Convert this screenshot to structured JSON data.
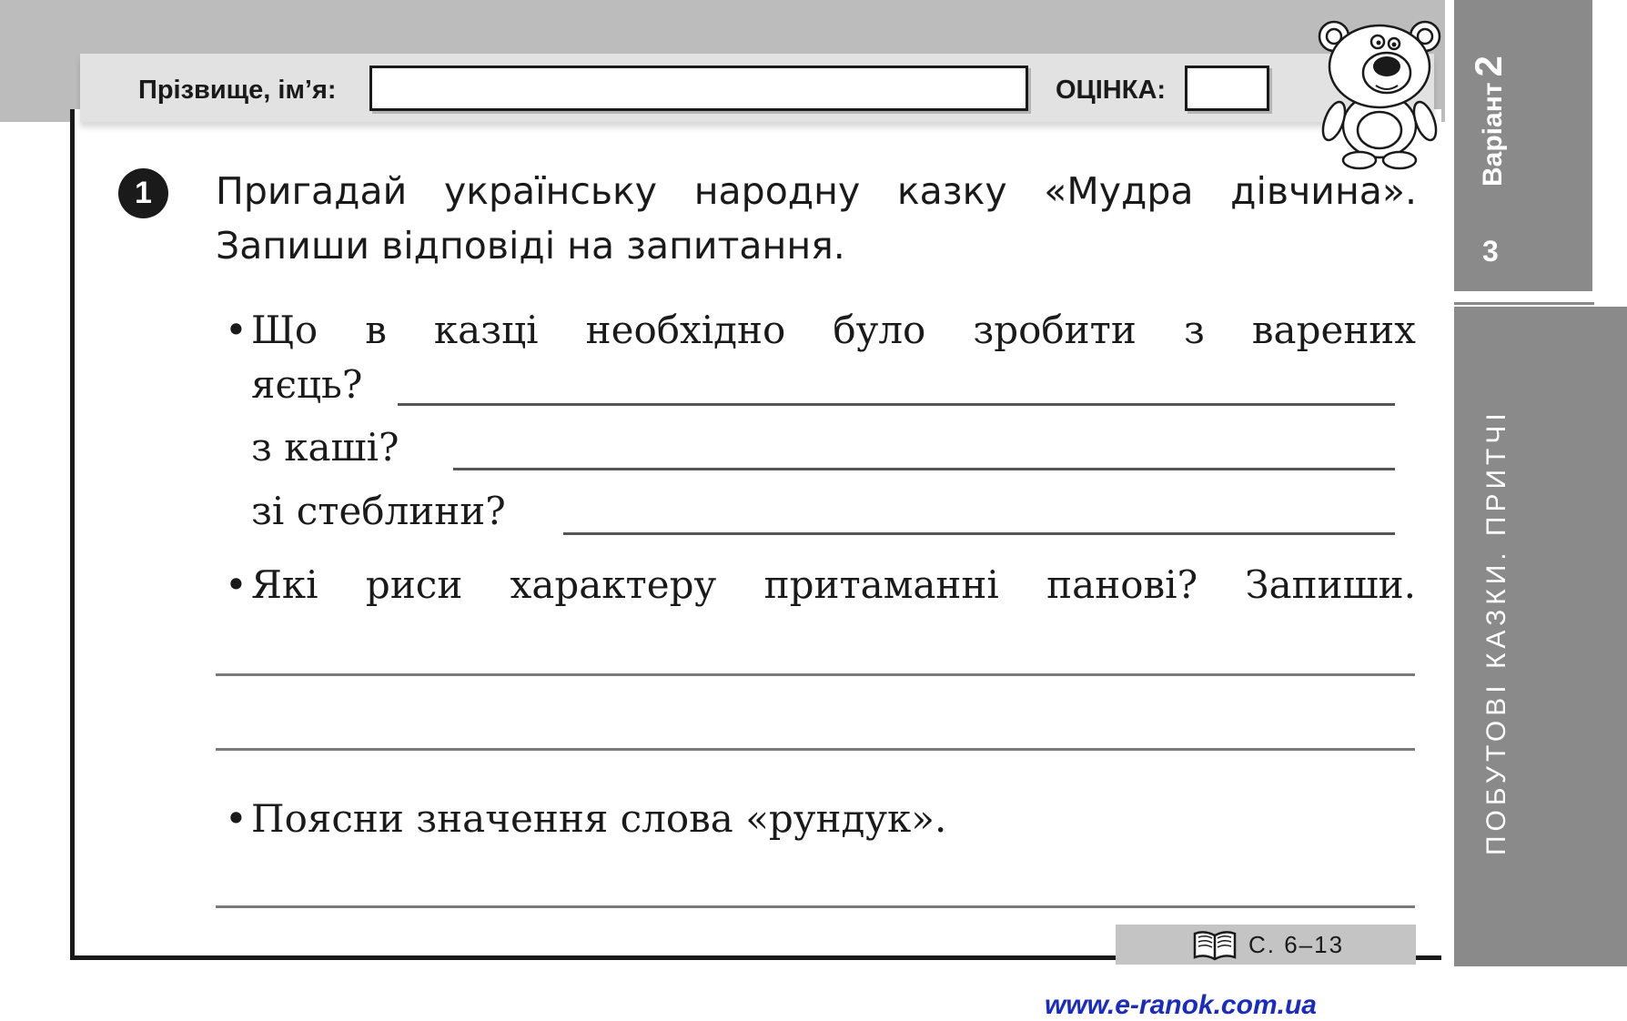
{
  "header": {
    "name_label": "Прізвище, ім’я:",
    "name_value": "",
    "grade_label": "ОЦІНКА:",
    "grade_value": ""
  },
  "sidebar": {
    "variant_word": "Варіант",
    "variant_number": "2",
    "sub_number": "3",
    "section_title": "ПОБУТОВІ КАЗКИ. ПРИТЧІ"
  },
  "task": {
    "number": "1",
    "instruction": "Пригадай українську народну казку «Мудра дівчина». Запиши відповіді на запитання.",
    "bullet": "•",
    "q1_line1": "Що в казці необхідно було зробити з варених",
    "q1_line2": "яєць?",
    "q1_b": "з каші?",
    "q1_c": "зі стеблини?",
    "q2": "Які риси характеру притаманні панові? Запиши.",
    "q3": "Поясни значення слова «рундук»."
  },
  "footer": {
    "page_ref": "С. 6–13",
    "website": "www.e-ranok.com.ua"
  },
  "colors": {
    "sidebar_grey": "#8a8a8a",
    "band_grey": "#bcbcbc",
    "link_blue": "#1a2bc0"
  }
}
